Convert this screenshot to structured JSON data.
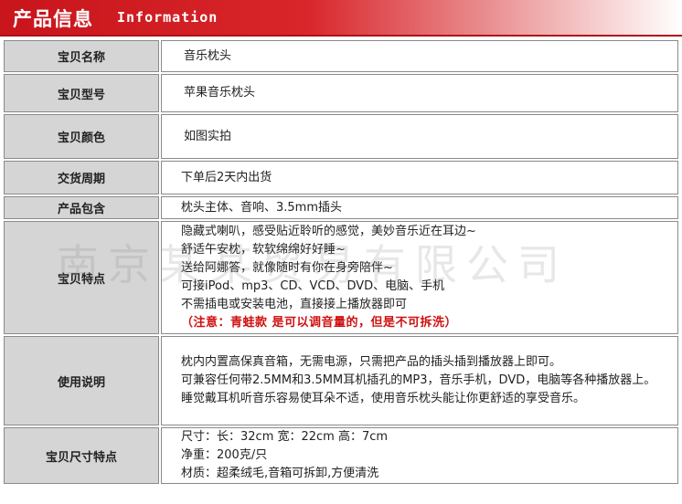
{
  "header": {
    "title_cn": "产品信息",
    "title_en": "Information"
  },
  "watermark": "南京某某贸易有限公司",
  "rows": [
    {
      "label": "宝贝名称",
      "lines": [
        "音乐枕头"
      ]
    },
    {
      "label": "宝贝型号",
      "lines": [
        "苹果音乐枕头"
      ]
    },
    {
      "label": "宝贝颜色",
      "lines": [
        "如图实拍"
      ]
    },
    {
      "label": "交货周期",
      "lines": [
        "下单后2天内出货"
      ]
    },
    {
      "label": "产品包含",
      "lines": [
        "枕头主体、音响、3.5mm插头"
      ]
    },
    {
      "label": "宝贝特点",
      "lines": [
        "隐藏式喇叭，感受贴近聆听的感觉，美妙音乐近在耳边~",
        "舒适午安枕，软软绵绵好好睡~",
        "送给阿娜答，就像随时有你在身旁陪伴~",
        "可接iPod、mp3、CD、VCD、DVD、电脑、手机",
        "不需插电或安装电池，直接接上播放器即可"
      ],
      "note": "（注意：青蛙款 是可以调音量的，但是不可拆洗）"
    },
    {
      "label": "使用说明",
      "lines": [
        "枕内内置高保真音箱，无需电源，只需把产品的插头插到播放器上即可。",
        "可兼容任何带2.5MM和3.5MM耳机插孔的MP3，音乐手机，DVD，电脑等各种播放器上。",
        "睡觉戴耳机听音乐容易使耳朵不适，使用音乐枕头能让你更舒适的享受音乐。"
      ]
    },
    {
      "label": "宝贝尺寸特点",
      "lines": [
        "尺寸：长：32cm 宽：22cm 高：7cm",
        "净重：200克/只",
        "材质：超柔绒毛,音箱可拆卸,方便清洗"
      ]
    }
  ]
}
